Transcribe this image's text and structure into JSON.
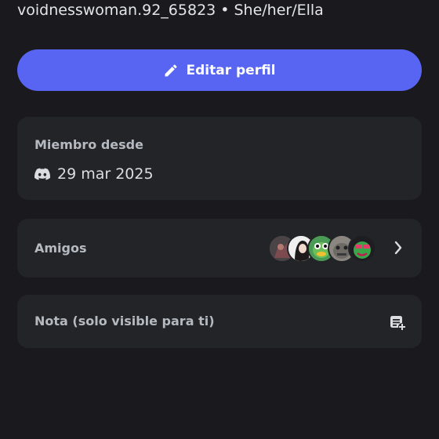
{
  "profile": {
    "username": "voidnesswoman.92_65823",
    "separator": "•",
    "pronouns": "She/her/Ella"
  },
  "edit_button": {
    "label": "Editar perfil",
    "icon": "pencil-icon"
  },
  "member_card": {
    "label": "Miembro desde",
    "date": "29 mar 2025",
    "icon": "discord-icon"
  },
  "friends_card": {
    "label": "Amigos",
    "avatar_count": 5,
    "chevron_icon": "chevron-right-icon"
  },
  "note_card": {
    "label": "Nota (solo visible para ti)",
    "icon": "note-add-icon"
  },
  "colors": {
    "accent": "#5865f2",
    "background": "#1a1a1e",
    "card": "#232428"
  }
}
